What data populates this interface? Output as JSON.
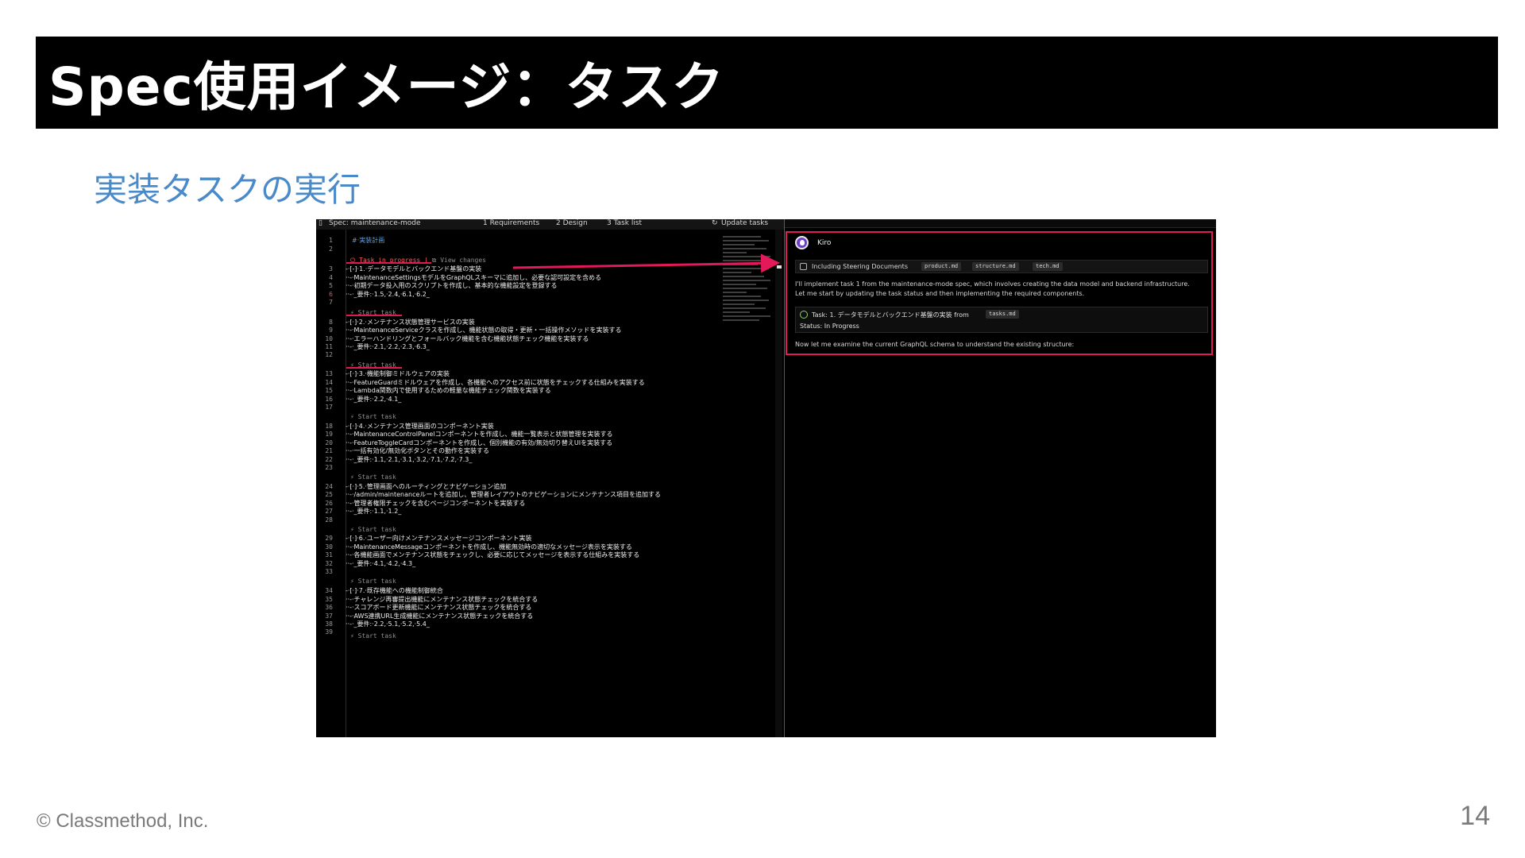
{
  "slide": {
    "title": "Spec使用イメージ：タスク",
    "subtitle": "実装タスクの実行",
    "copyright": "© Classmethod, Inc.",
    "page_number": "14"
  },
  "editor": {
    "tab_file": "Spec: maintenance-mode",
    "tab_requirements": "1   Requirements",
    "tab_design": "2   Design",
    "tab_tasklist": "3   Task list",
    "update_tasks": "Update tasks",
    "lines": [
      {
        "n": "1",
        "text": "#·実装計画",
        "heading": true
      },
      {
        "n": "2",
        "text": ""
      },
      {
        "n": "3",
        "text": "-·[-]·1.·データモデルとバックエンド基盤の実装"
      },
      {
        "n": "4",
        "text": "··-·MaintenanceSettingsモデルをGraphQLスキーマに追加し、必要な認可設定を含める"
      },
      {
        "n": "5",
        "text": "··-·初期データ投入用のスクリプトを作成し、基本的な機能設定を登録する"
      },
      {
        "n": "6",
        "text": "··-·_要件:·1.5,·2.4,·6.1,·6.2_",
        "current": true
      },
      {
        "n": "7",
        "text": ""
      },
      {
        "n": "8",
        "text": "-·[·]·2.·メンテナンス状態管理サービスの実装"
      },
      {
        "n": "9",
        "text": "··-·MaintenanceServiceクラスを作成し、機能状態の取得・更新・一括操作メソッドを実装する"
      },
      {
        "n": "10",
        "text": "··-·エラーハンドリングとフォールバック機能を含む機能状態チェック機能を実装する"
      },
      {
        "n": "11",
        "text": "··-·_要件:·2.1,·2.2,·2.3,·6.3_"
      },
      {
        "n": "12",
        "text": ""
      },
      {
        "n": "13",
        "text": "-·[·]·3.·機能制御ミドルウェアの実装"
      },
      {
        "n": "14",
        "text": "··-·FeatureGuardミドルウェアを作成し、各機能へのアクセス前に状態をチェックする仕組みを実装する"
      },
      {
        "n": "15",
        "text": "··-·Lambda関数内で使用するための軽量な機能チェック関数を実装する"
      },
      {
        "n": "16",
        "text": "··-·_要件:·2.2,·4.1_"
      },
      {
        "n": "17",
        "text": ""
      },
      {
        "n": "18",
        "text": "-·[·]·4.·メンテナンス管理画面のコンポーネント実装"
      },
      {
        "n": "19",
        "text": "··-·MaintenanceControlPanelコンポーネントを作成し、機能一覧表示と状態管理を実装する"
      },
      {
        "n": "20",
        "text": "··-·FeatureToggleCardコンポーネントを作成し、個別機能の有効/無効切り替えUIを実装する"
      },
      {
        "n": "21",
        "text": "··-·一括有効化/無効化ボタンとその動作を実装する"
      },
      {
        "n": "22",
        "text": "··-·_要件:·1.1,·2.1,·3.1,·3.2,·7.1,·7.2,·7.3_"
      },
      {
        "n": "23",
        "text": ""
      },
      {
        "n": "24",
        "text": "-·[·]·5.·管理画面へのルーティングとナビゲーション追加"
      },
      {
        "n": "25",
        "text": "··-·/admin/maintenanceルートを追加し、管理者レイアウトのナビゲーションにメンテナンス項目を追加する"
      },
      {
        "n": "26",
        "text": "··-·管理者権限チェックを含むページコンポーネントを実装する"
      },
      {
        "n": "27",
        "text": "··-·_要件:·1.1,·1.2_"
      },
      {
        "n": "28",
        "text": ""
      },
      {
        "n": "29",
        "text": "-·[·]·6.·ユーザー向けメンテナンスメッセージコンポーネント実装"
      },
      {
        "n": "30",
        "text": "··-·MaintenanceMessageコンポーネントを作成し、機能無効時の適切なメッセージ表示を実装する"
      },
      {
        "n": "31",
        "text": "··-·各機能画面でメンテナンス状態をチェックし、必要に応じてメッセージを表示する仕組みを実装する"
      },
      {
        "n": "32",
        "text": "··-·_要件:·4.1,·4.2,·4.3_"
      },
      {
        "n": "33",
        "text": ""
      },
      {
        "n": "34",
        "text": "-·[·]·7.·既存機能への機能制御統合"
      },
      {
        "n": "35",
        "text": "··-·チャレンジ再審提出機能にメンテナンス状態チェックを統合する"
      },
      {
        "n": "36",
        "text": "··-·スコアボード更新機能にメンテナンス状態チェックを統合する"
      },
      {
        "n": "37",
        "text": "··-·AWS連携URL生成機能にメンテナンス状態チェックを統合する"
      },
      {
        "n": "38",
        "text": "··-·_要件:·2.2,·5.1,·5.2,·5.4_"
      },
      {
        "n": "39",
        "text": ""
      }
    ],
    "lens_in_progress": "Task in progress",
    "lens_view_changes": "View changes",
    "lens_start": "Start task"
  },
  "chat": {
    "agent_name": "Kiro",
    "steering_label": "Including Steering Documents",
    "steering_chips": [
      "product.md",
      "structure.md",
      "tech.md"
    ],
    "message_1": "I'll implement task 1 from the maintenance-mode spec, which involves creating the data model and backend infrastructure.",
    "message_2": "Let me start by updating the task status and then implementing the required components.",
    "task_title": "Task: 1. データモデルとバックエンド基盤の実装 from",
    "task_file": "tasks.md",
    "task_status": "Status: In Progress",
    "message_3": "Now let me examine the current GraphQL schema to understand the existing structure:"
  },
  "colors": {
    "accent_red": "#e3195a",
    "subtitle_blue": "#4a8ac9",
    "heading_blue": "#5aa0e6"
  }
}
